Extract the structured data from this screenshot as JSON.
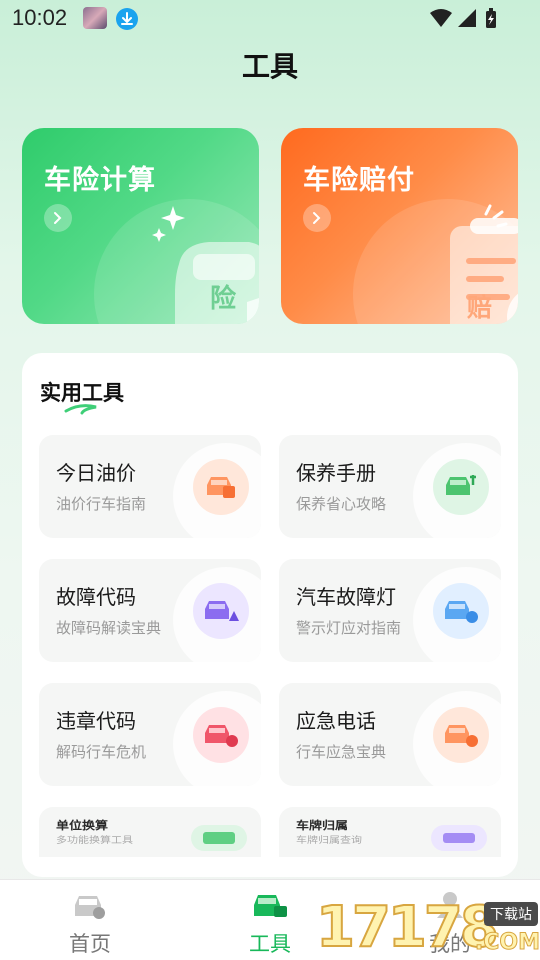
{
  "status_bar": {
    "time": "10:02"
  },
  "header": {
    "title": "工具"
  },
  "feature_cards": [
    {
      "title": "车险计算",
      "badge_text": "险"
    },
    {
      "title": "车险赔付",
      "badge_text": "赔"
    }
  ],
  "tools_section": {
    "heading": "实用工具",
    "tools": [
      {
        "title": "今日油价",
        "subtitle": "油价行车指南",
        "icon": "fuel-car-icon",
        "color": "#ff8a4c"
      },
      {
        "title": "保养手册",
        "subtitle": "保养省心攻略",
        "icon": "maintenance-car-icon",
        "color": "#4cc46f"
      },
      {
        "title": "故障代码",
        "subtitle": "故障码解读宝典",
        "icon": "fault-code-icon",
        "color": "#8b6cf0"
      },
      {
        "title": "汽车故障灯",
        "subtitle": "警示灯应对指南",
        "icon": "warning-light-icon",
        "color": "#4c9df0"
      },
      {
        "title": "违章代码",
        "subtitle": "解码行车危机",
        "icon": "violation-icon",
        "color": "#f0566a"
      },
      {
        "title": "应急电话",
        "subtitle": "行车应急宝典",
        "icon": "emergency-phone-icon",
        "color": "#ff8a4c"
      },
      {
        "title": "单位换算",
        "subtitle": "多功能换算工具",
        "icon": "unit-convert-icon",
        "color": "#4cc46f"
      },
      {
        "title": "车牌归属",
        "subtitle": "车牌归属查询",
        "icon": "plate-lookup-icon",
        "color": "#8b6cf0"
      }
    ]
  },
  "bottom_nav": {
    "items": [
      {
        "label": "首页",
        "icon": "home-car-icon"
      },
      {
        "label": "工具",
        "icon": "tools-car-icon",
        "active": true
      },
      {
        "label": "我的",
        "icon": "profile-icon"
      }
    ]
  },
  "watermark": {
    "number": "17178",
    "tag": "下载站",
    "suffix": ".COM"
  },
  "colors": {
    "accent_green": "#18b85a",
    "accent_orange": "#ff6a1f"
  }
}
